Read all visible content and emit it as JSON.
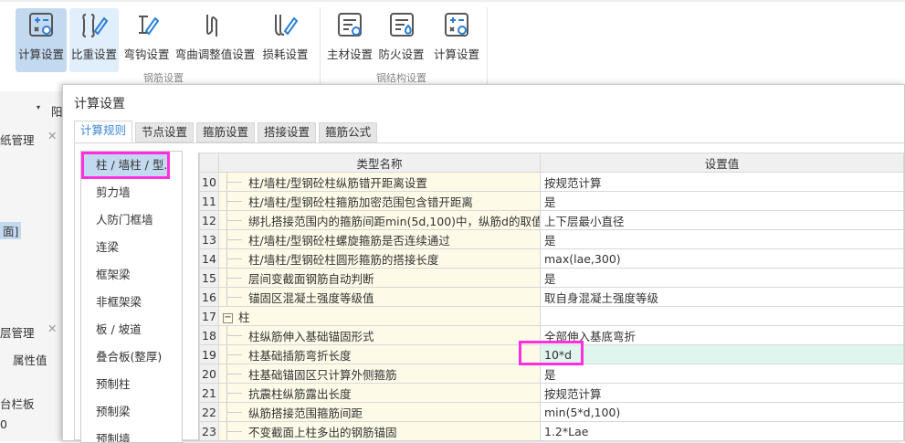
{
  "toolbar": {
    "buttons": [
      {
        "label": "计算设置",
        "icon": "calc-settings-icon"
      },
      {
        "label": "比重设置",
        "icon": "weight-edit-icon"
      },
      {
        "label": "弯钩设置",
        "icon": "hook-edit-icon"
      },
      {
        "label": "弯曲调整值设置",
        "icon": "bend-icon"
      },
      {
        "label": "损耗设置",
        "icon": "loss-edit-icon"
      },
      {
        "label": "主材设置",
        "icon": "material-settings-icon"
      },
      {
        "label": "防火设置",
        "icon": "fire-settings-icon"
      },
      {
        "label": "计算设置",
        "icon": "calc-settings-icon"
      }
    ],
    "groups": [
      "钢筋设置",
      "钢结构设置"
    ]
  },
  "left_panel": {
    "char": "阳",
    "drawing_mgmt": "纸管理",
    "floor_mgmt": "层管理",
    "prop_value": "属性值",
    "row1": "台栏板",
    "row2": "0",
    "tag": "面]"
  },
  "dialog": {
    "title": "计算设置",
    "tabs": [
      "计算规则",
      "节点设置",
      "箍筋设置",
      "搭接设置",
      "箍筋公式"
    ],
    "categories": [
      "柱 / 墙柱 / 型..",
      "剪力墙",
      "人防门框墙",
      "连梁",
      "框架梁",
      "非框架梁",
      "板 / 坡道",
      "叠合板(整厚)",
      "预制柱",
      "预制梁",
      "预制墙"
    ],
    "columns": [
      "类型名称",
      "设置值"
    ],
    "rows": [
      {
        "no": "10",
        "name": "柱/墙柱/型钢砼柱纵筋错开距离设置",
        "value": "按规范计算"
      },
      {
        "no": "11",
        "name": "柱/墙柱/型钢砼柱箍筋加密范围包含错开距离",
        "value": "是"
      },
      {
        "no": "12",
        "name": "绑扎搭接范围内的箍筋间距min(5d,100)中，纵筋d的取值",
        "value": "上下层最小直径"
      },
      {
        "no": "13",
        "name": "柱/墙柱/型钢砼柱螺旋箍筋是否连续通过",
        "value": "是"
      },
      {
        "no": "14",
        "name": "柱/墙柱/型钢砼柱圆形箍筋的搭接长度",
        "value": "max(lae,300)"
      },
      {
        "no": "15",
        "name": "层间变截面钢筋自动判断",
        "value": "是"
      },
      {
        "no": "16",
        "name": "锚固区混凝土强度等级值",
        "value": "取自身混凝土强度等级"
      },
      {
        "no": "17",
        "name": "柱",
        "value": "",
        "group": true
      },
      {
        "no": "18",
        "name": "柱纵筋伸入基础锚固形式",
        "value": "全部伸入基底弯折"
      },
      {
        "no": "19",
        "name": "柱基础插筋弯折长度",
        "value": "10*d",
        "highlight": true
      },
      {
        "no": "20",
        "name": "柱基础锚固区只计算外侧箍筋",
        "value": "是"
      },
      {
        "no": "21",
        "name": "抗震柱纵筋露出长度",
        "value": "按规范计算"
      },
      {
        "no": "22",
        "name": "纵筋搭接范围箍筋间距",
        "value": "min(5*d,100)"
      },
      {
        "no": "23",
        "name": "不变截面上柱多出的钢筋锚固",
        "value": "1.2*Lae"
      }
    ]
  }
}
